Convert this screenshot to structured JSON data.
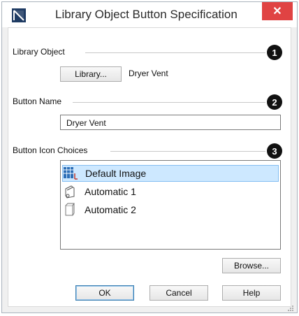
{
  "window": {
    "title": "Library Object Button Specification"
  },
  "badges": {
    "one": "1",
    "two": "2",
    "three": "3"
  },
  "library_object": {
    "label": "Library Object",
    "library_button": "Library...",
    "selected_name": "Dryer Vent"
  },
  "button_name": {
    "label": "Button Name",
    "value": "Dryer Vent"
  },
  "icon_choices": {
    "label": "Button Icon Choices",
    "items": [
      {
        "label": "Default Image",
        "icon": "default-image-icon"
      },
      {
        "label": "Automatic 1",
        "icon": "automatic-1-icon"
      },
      {
        "label": "Automatic 2",
        "icon": "automatic-2-icon"
      }
    ],
    "browse_button": "Browse..."
  },
  "footer": {
    "ok": "OK",
    "cancel": "Cancel",
    "help": "Help"
  },
  "colors": {
    "close": "#e04343",
    "selection": "#cde8ff",
    "selection_border": "#83bdf2"
  }
}
